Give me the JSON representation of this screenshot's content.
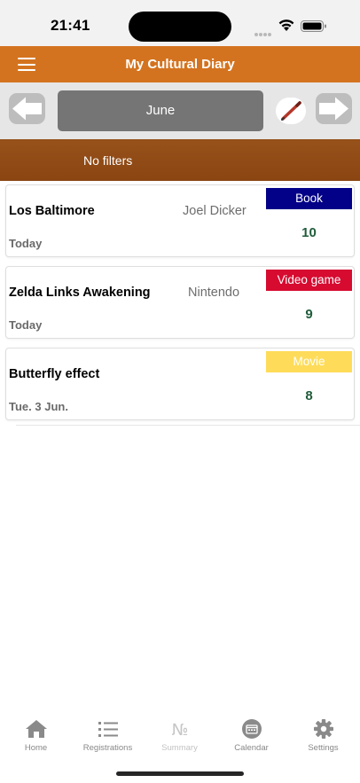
{
  "status_bar": {
    "time": "21:41",
    "icons": [
      "signal-dots-icon",
      "wifi-icon",
      "battery-icon"
    ]
  },
  "header": {
    "title": "My Cultural Diary",
    "menu_icon": "hamburger-menu-icon",
    "color": "#d4731f"
  },
  "month_nav": {
    "month": "June",
    "prev_icon": "arrow-left-icon",
    "next_icon": "arrow-right-icon",
    "edit_icon": "pencil-icon"
  },
  "filter": {
    "label": "No filters",
    "color": "#8f4c16"
  },
  "entries": [
    {
      "title": "Los Baltimore",
      "author": "Joel Dicker",
      "date": "Today",
      "type": "Book",
      "type_bg": "#030187",
      "type_color": "#ffffff",
      "rating": "10"
    },
    {
      "title": "Zelda Links Awakening",
      "author": "Nintendo",
      "date": "Today",
      "type": "Video game",
      "type_bg": "#d70a30",
      "type_color": "#ffffff",
      "rating": "9"
    },
    {
      "title": "Butterfly effect",
      "author": "",
      "date": "Tue. 3 Jun.",
      "type": "Movie",
      "type_bg": "#fedc5a",
      "type_color": "#ffffff",
      "rating": "8"
    }
  ],
  "tabs": [
    {
      "label": "Home",
      "icon": "home-icon",
      "active": true
    },
    {
      "label": "Registrations",
      "icon": "list-icon",
      "active": true
    },
    {
      "label": "Summary",
      "icon": "numero-icon",
      "active": false
    },
    {
      "label": "Calendar",
      "icon": "calendar-icon",
      "active": true
    },
    {
      "label": "Settings",
      "icon": "gear-icon",
      "active": true
    }
  ]
}
